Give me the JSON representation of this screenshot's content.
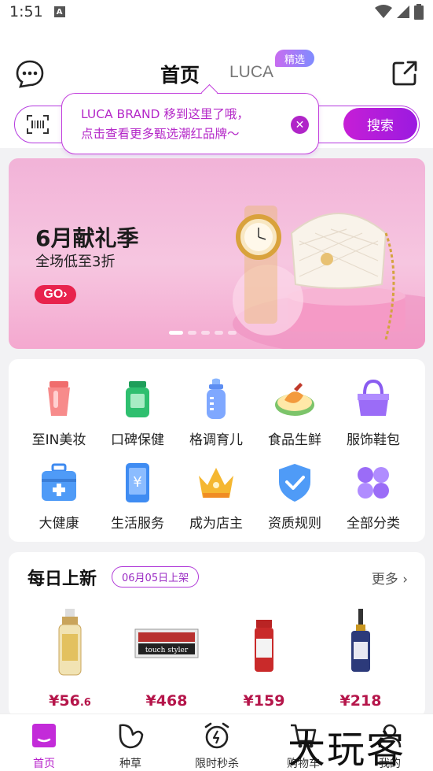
{
  "status_bar": {
    "time": "1:51",
    "notification_icon": "A"
  },
  "header": {
    "tab_home": "首页",
    "tab_luca": "LUCA",
    "badge": "精选",
    "icons": [
      "chat-bubble-icon",
      "share-icon"
    ]
  },
  "search": {
    "button_label": "搜索"
  },
  "tooltip": {
    "line1": "LUCA BRAND 移到这里了哦，",
    "line2": "点击查看更多甄选潮红品牌～"
  },
  "banner": {
    "title": "6月献礼季",
    "subtitle": "全场低至3折",
    "go_label": "GO›"
  },
  "categories": [
    {
      "label": "至IN美妆",
      "icon": "cosmetics-tube-icon"
    },
    {
      "label": "口碑保健",
      "icon": "supplement-bottle-icon"
    },
    {
      "label": "格调育儿",
      "icon": "baby-bottle-icon"
    },
    {
      "label": "食品生鲜",
      "icon": "food-plate-icon"
    },
    {
      "label": "服饰鞋包",
      "icon": "handbag-icon"
    },
    {
      "label": "大健康",
      "icon": "medical-kit-icon"
    },
    {
      "label": "生活服务",
      "icon": "yuan-phone-icon"
    },
    {
      "label": "成为店主",
      "icon": "crown-icon"
    },
    {
      "label": "资质规则",
      "icon": "shield-check-icon"
    },
    {
      "label": "全部分类",
      "icon": "grid-four-icon"
    }
  ],
  "daily_new": {
    "title": "每日上新",
    "date_label": "06月05日上架",
    "more_label": "更多 ›",
    "products": [
      {
        "price_main": "¥56",
        "price_decimal": ".6"
      },
      {
        "price_main": "¥468",
        "price_decimal": ""
      },
      {
        "price_main": "¥159",
        "price_decimal": ""
      },
      {
        "price_main": "¥218",
        "price_decimal": ""
      }
    ]
  },
  "tab_bar": [
    {
      "label": "首页",
      "active": true
    },
    {
      "label": "种草",
      "active": false
    },
    {
      "label": "限时秒杀",
      "active": false
    },
    {
      "label": "购物车",
      "active": false
    },
    {
      "label": "我的",
      "active": false
    }
  ],
  "watermark": "大玩客",
  "colors": {
    "accent": "#b722cb",
    "price": "#b5154a",
    "banner_go": "#e8234d"
  }
}
